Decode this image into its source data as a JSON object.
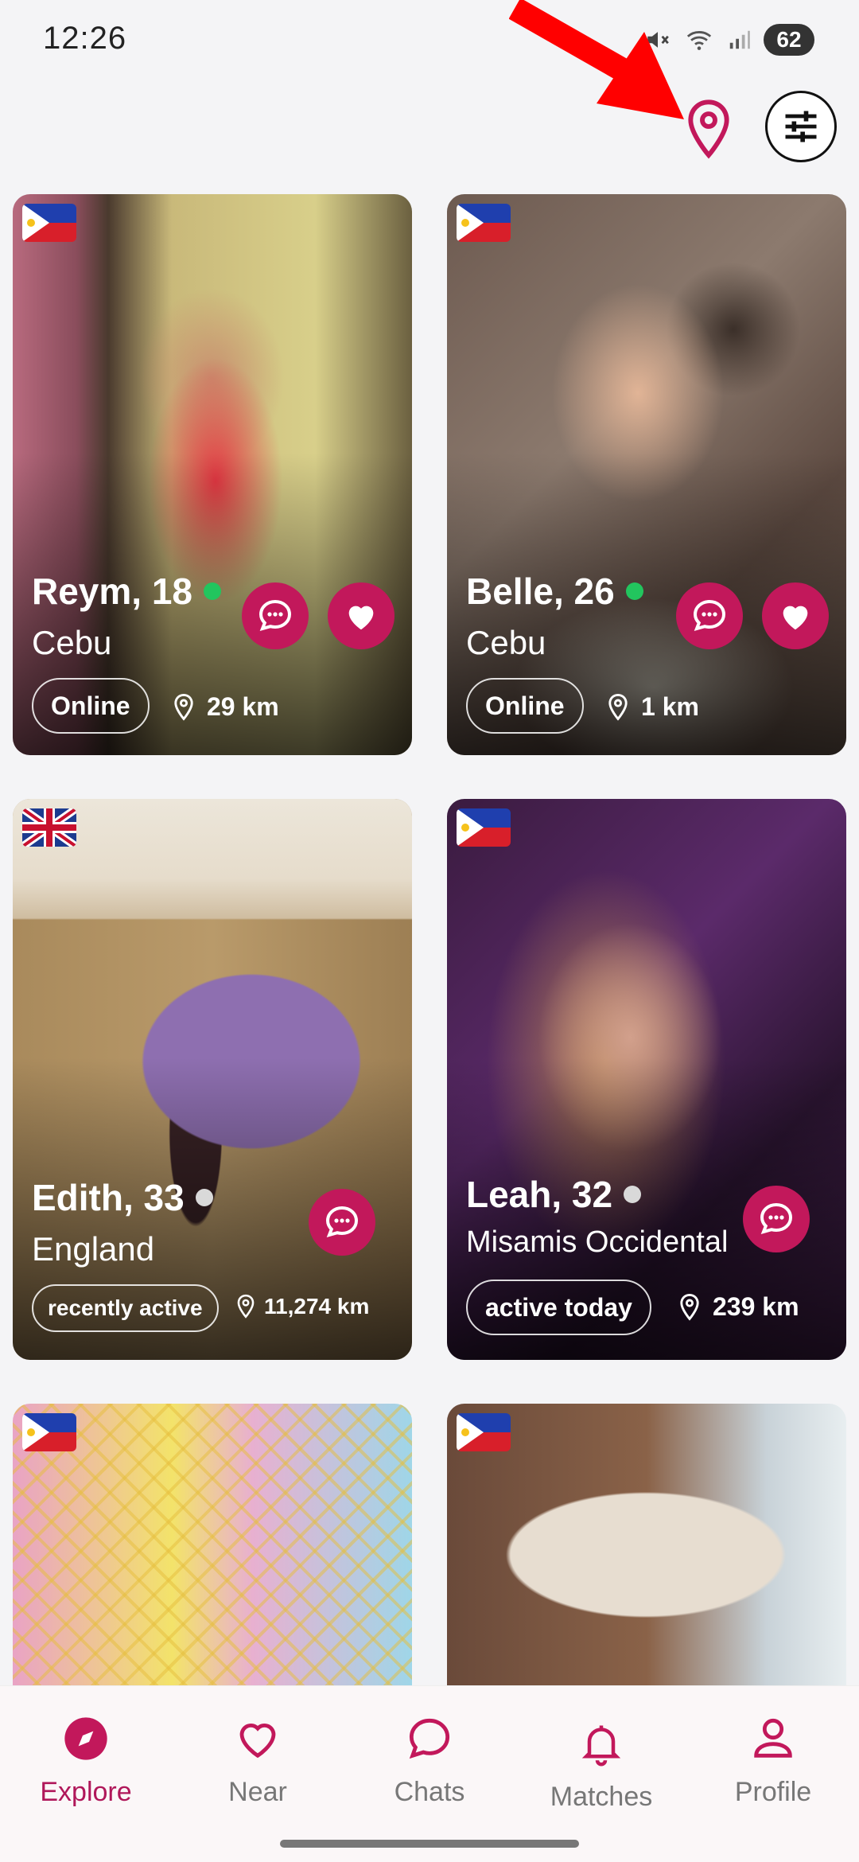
{
  "status_bar": {
    "time": "12:26",
    "battery": "62"
  },
  "header": {
    "location_icon": "map-pin-icon",
    "filter_icon": "sliders-icon"
  },
  "cards": [
    {
      "name_age": "Reym, 18",
      "city": "Cebu",
      "status": "Online",
      "distance": "29 km",
      "flag": "PH",
      "online": true,
      "has_like": true
    },
    {
      "name_age": "Belle, 26",
      "city": "Cebu",
      "status": "Online",
      "distance": "1 km",
      "flag": "PH",
      "online": true,
      "has_like": true
    },
    {
      "name_age": "Edith, 33",
      "city": "England",
      "status": "recently active",
      "distance": "11,274 km",
      "flag": "UK",
      "online": false,
      "has_like": false
    },
    {
      "name_age": "Leah, 32",
      "city": "Misamis Occidental",
      "status": "active today",
      "distance": "239 km",
      "flag": "PH",
      "online": false,
      "has_like": false
    }
  ],
  "nav": {
    "items": [
      {
        "label": "Explore",
        "icon": "compass-icon",
        "active": true
      },
      {
        "label": "Near",
        "icon": "heart-icon",
        "active": false
      },
      {
        "label": "Chats",
        "icon": "chat-bubble-icon",
        "active": false
      },
      {
        "label": "Matches",
        "icon": "bell-icon",
        "active": false
      },
      {
        "label": "Profile",
        "icon": "person-icon",
        "active": false
      }
    ]
  },
  "colors": {
    "accent": "#c2185b",
    "online": "#22c55e",
    "offline": "#d9d9d9",
    "annotation": "#ff0000"
  }
}
